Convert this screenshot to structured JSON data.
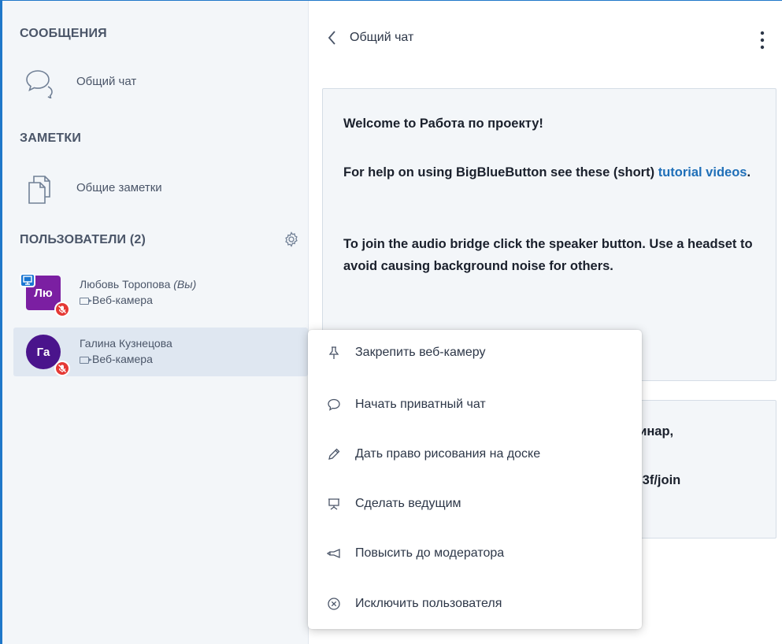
{
  "sidebar": {
    "messages_title": "СООБЩЕНИЯ",
    "public_chat_label": "Общий чат",
    "notes_title": "ЗАМЕТКИ",
    "shared_notes_label": "Общие заметки",
    "users_title": "ПОЛЬЗОВАТЕЛИ (2)",
    "users": [
      {
        "initials": "Лю",
        "name": "Любовь Торопова",
        "you_tag": "(Вы)",
        "status": "Веб-камера",
        "avatar_color": "#7b1fa2",
        "presenter": true,
        "muted": true
      },
      {
        "initials": "Га",
        "name": "Галина Кузнецова",
        "you_tag": "",
        "status": "Веб-камера",
        "avatar_color": "#4a148c",
        "presenter": false,
        "muted": true
      }
    ]
  },
  "chat": {
    "title": "Общий чат",
    "welcome": {
      "prefix": "Welcome to ",
      "meeting_name": "Работа по проекту",
      "suffix": "!",
      "help_text": "For help on using BigBlueButton see these (short)",
      "link_text": "tutorial videos",
      "link_suffix": ".",
      "audio_text": "To join the audio bridge click the speaker button. Use a headset to avoid causing background noise for others."
    },
    "second_message": {
      "line1": "бинар,",
      "line2": "-03f/join"
    }
  },
  "context_menu": {
    "items": [
      {
        "icon": "pin-icon",
        "label": "Закрепить веб-камеру"
      },
      {
        "icon": "chat-icon",
        "label": "Начать приватный чат"
      },
      {
        "icon": "pencil-icon",
        "label": "Дать право рисования на доске"
      },
      {
        "icon": "presentation-icon",
        "label": "Сделать ведущим"
      },
      {
        "icon": "promote-icon",
        "label": "Повысить до модератора"
      },
      {
        "icon": "remove-icon",
        "label": "Исключить пользователя"
      }
    ]
  },
  "colors": {
    "accent": "#1f77c9",
    "sidebar_bg": "#f3f6f9",
    "link": "#1f6fb8",
    "muted_badge": "#e53935",
    "presenter_badge": "#1976d2"
  }
}
